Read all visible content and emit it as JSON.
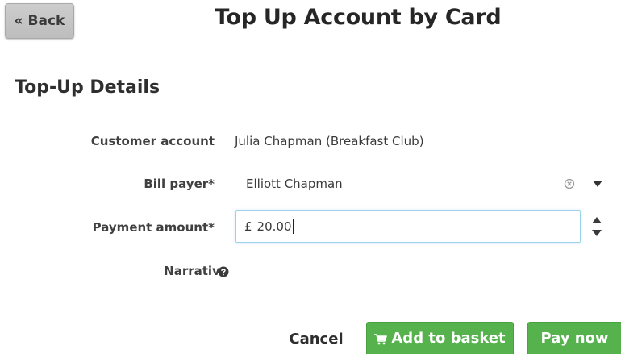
{
  "header": {
    "back_label": "« Back",
    "title": "Top Up Account by Card"
  },
  "section": {
    "title": "Top-Up Details"
  },
  "form": {
    "customer_account": {
      "label": "Customer account",
      "value": "Julia Chapman (Breakfast Club)"
    },
    "bill_payer": {
      "label": "Bill payer*",
      "value": "Elliott Chapman",
      "clear_icon": "clear-circle-icon",
      "dropdown_icon": "caret-down-icon"
    },
    "payment_amount": {
      "label": "Payment amount*",
      "currency": "£",
      "value": "20.00",
      "stepper_icon": "up-down-stepper-icon",
      "focus_color": "#9fd2e6"
    },
    "narrative": {
      "label": "Narrative",
      "help_icon": "question-circle-icon"
    }
  },
  "actions": {
    "cancel_label": "Cancel",
    "add_to_basket_label": "Add to basket",
    "add_to_basket_icon": "shopping-cart-icon",
    "pay_now_label": "Pay now",
    "primary_color": "#55b24c"
  }
}
